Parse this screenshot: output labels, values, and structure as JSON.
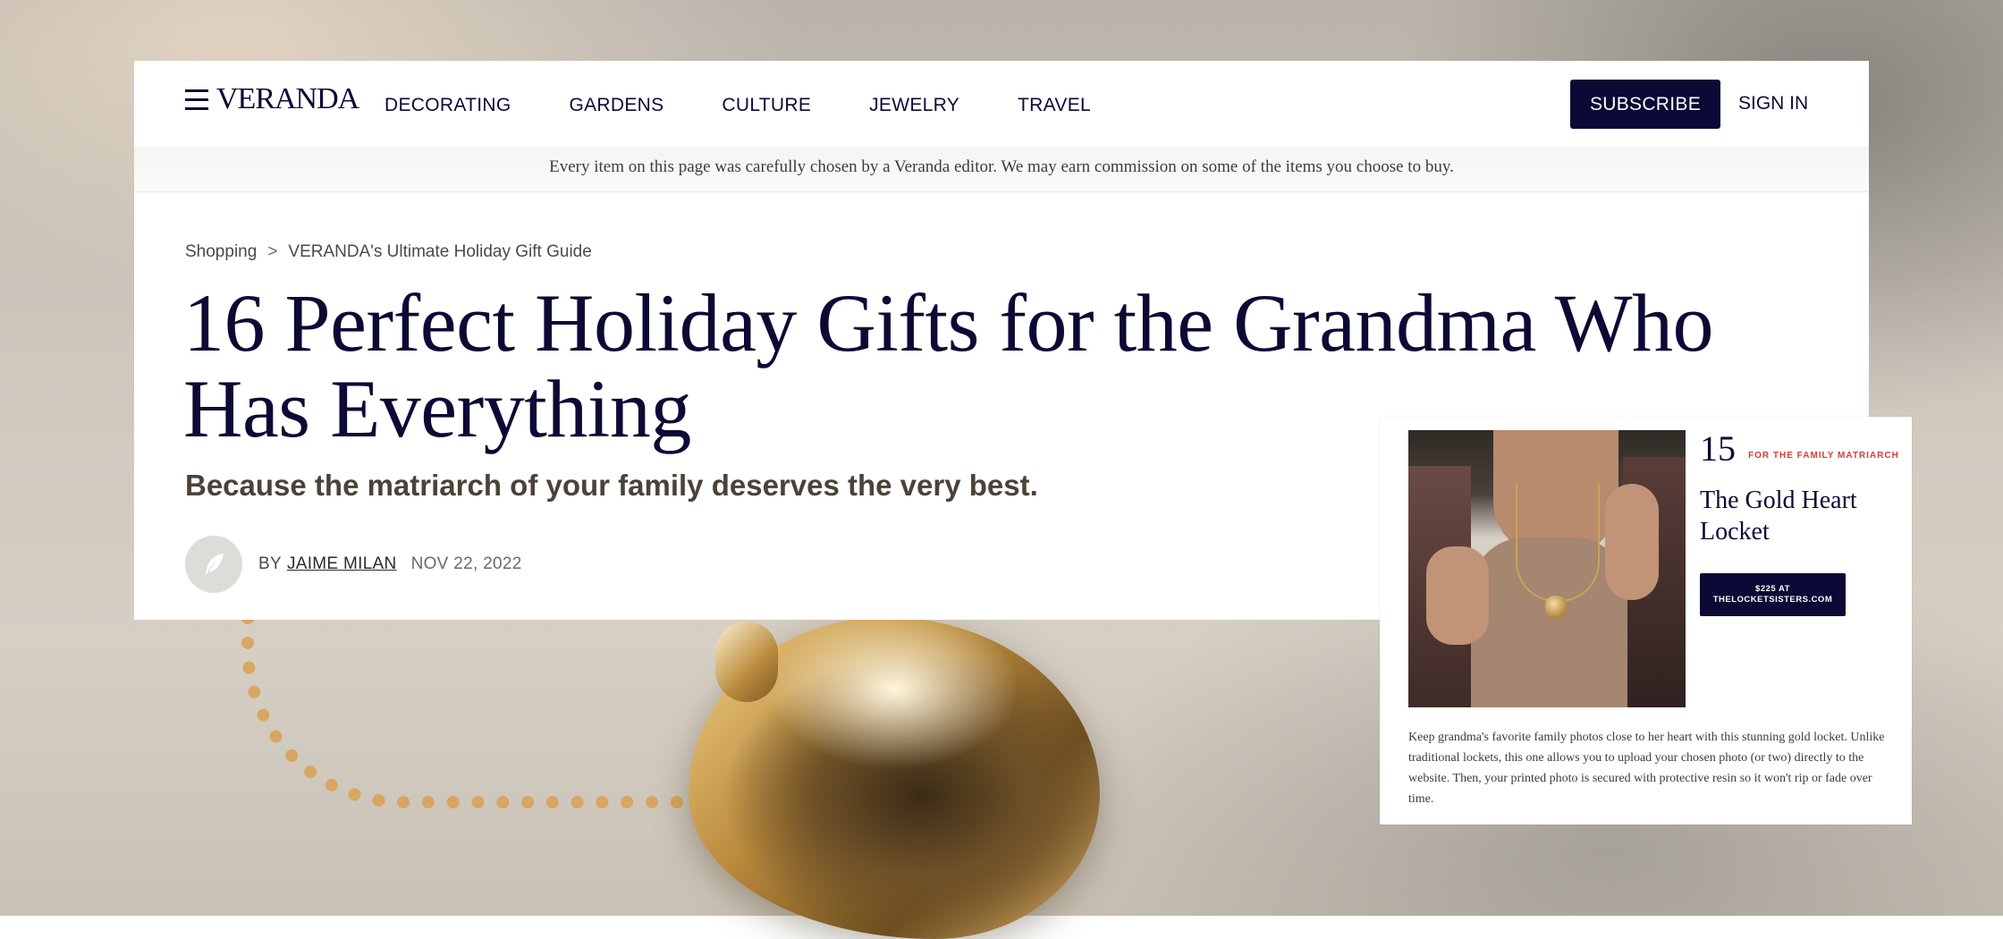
{
  "header": {
    "logo": "VERANDA",
    "nav": [
      "DECORATING",
      "GARDENS",
      "CULTURE",
      "JEWELRY",
      "TRAVEL"
    ],
    "subscribe_label": "SUBSCRIBE",
    "signin_label": "SIGN IN"
  },
  "disclaimer": "Every item on this page was carefully chosen by a Veranda editor. We may earn commission on some of the items you choose to buy.",
  "breadcrumb": {
    "items": [
      "Shopping",
      "VERANDA's Ultimate Holiday Gift Guide"
    ],
    "separator": ">"
  },
  "article": {
    "title": "16 Perfect Holiday Gifts for the Grandma Who Has Everything",
    "dek": "Because the matriarch of your family deserves the very best.",
    "byline_prefix": "BY",
    "author": "JAIME MILAN",
    "date": "NOV 22, 2022"
  },
  "product": {
    "number": "15",
    "tag": "FOR THE FAMILY MATRIARCH",
    "title": "The Gold Heart Locket",
    "button_line1": "$225 AT",
    "button_line2": "THELOCKETSISTERS.COM",
    "description": "Keep grandma's favorite family photos close to her heart with this stunning gold locket. Unlike traditional lockets, this one allows you to upload your chosen photo (or two) directly to the website. Then, your printed photo is secured with protective resin so it won't rip or fade over time."
  },
  "colors": {
    "brand_navy": "#0b0935",
    "tag_red": "#d0403a",
    "dek_brown": "#4b4238"
  },
  "icons": {
    "menu": "hamburger-menu-icon",
    "avatar": "quill-feather-icon"
  }
}
